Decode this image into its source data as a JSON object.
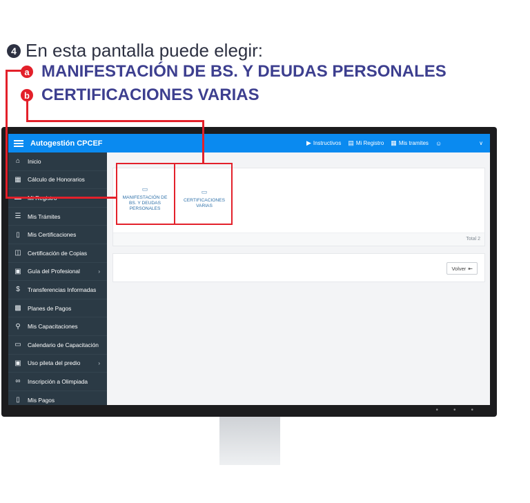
{
  "instruction": {
    "step_number": "4",
    "text": "En esta pantalla puede elegir:",
    "options": [
      {
        "marker": "a",
        "label": "MANIFESTACIÓN DE BS. Y DEUDAS PERSONALES"
      },
      {
        "marker": "b",
        "label": "CERTIFICACIONES VARIAS"
      }
    ]
  },
  "colors": {
    "accent": "#0a8af0",
    "sidebar": "#2b3a45",
    "highlight": "#e3202a",
    "option_text": "#3d3f8f"
  },
  "header": {
    "title": "Autogestión CPCEF",
    "nav": [
      {
        "icon": "play-circle-icon",
        "label": "Instructivos"
      },
      {
        "icon": "id-card-icon",
        "label": "Mi Registro"
      },
      {
        "icon": "calculator-icon",
        "label": "Mis tramites"
      }
    ],
    "user_icon": "user-icon",
    "dropdown_icon": "chevron-down-icon"
  },
  "sidebar": {
    "items": [
      {
        "icon": "home-icon",
        "label": "Inicio"
      },
      {
        "icon": "calculator-icon",
        "label": "Cálculo de Honorarios"
      },
      {
        "icon": "id-card-icon",
        "label": "Mi Registro"
      },
      {
        "icon": "checklist-icon",
        "label": "Mis Trámites"
      },
      {
        "icon": "certificate-icon",
        "label": "Mis Certificaciones"
      },
      {
        "icon": "copies-icon",
        "label": "Certificación de Copias"
      },
      {
        "icon": "image-icon",
        "label": "Guía del Profesional",
        "submenu": true
      },
      {
        "icon": "dollar-icon",
        "label": "Transferencias Informadas"
      },
      {
        "icon": "grid-icon",
        "label": "Planes de Pagos"
      },
      {
        "icon": "training-icon",
        "label": "Mis Capacitaciones"
      },
      {
        "icon": "calendar-icon",
        "label": "Calendario de Capacitación"
      },
      {
        "icon": "image-icon",
        "label": "Uso pileta del predio",
        "submenu": true
      },
      {
        "icon": "bicycle-icon",
        "label": "Inscripción a Olimpiada"
      },
      {
        "icon": "document-icon",
        "label": "Mis Pagos"
      }
    ]
  },
  "main": {
    "tiles": [
      {
        "icon": "folder-icon",
        "label": "MANIFESTACIÓN DE BS. Y DEUDAS PERSONALES"
      },
      {
        "icon": "folder-icon",
        "label": "CERTIFICACIONES VARIAS"
      }
    ],
    "total": "Total 2",
    "back_button": "Volver"
  }
}
